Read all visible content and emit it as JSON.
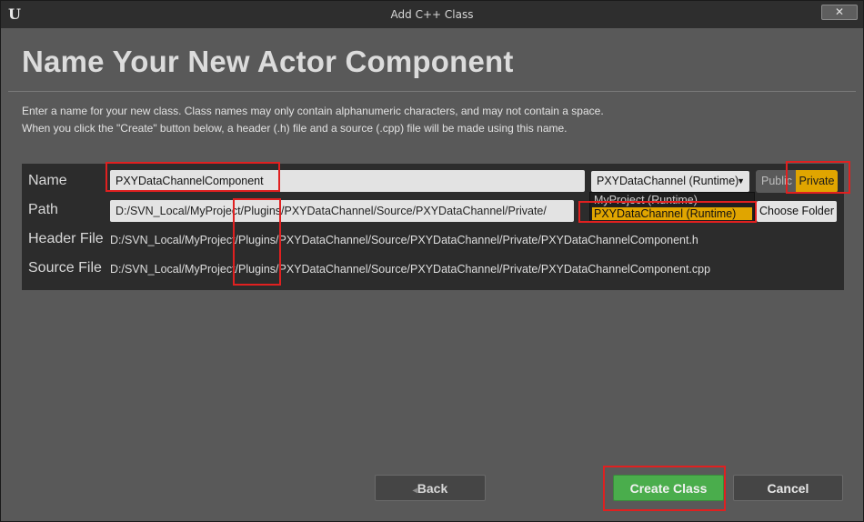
{
  "window": {
    "title": "Add C++ Class",
    "close_label": "✕"
  },
  "heading": "Name Your New Actor Component",
  "description": {
    "line1": "Enter a name for your new class. Class names may only contain alphanumeric characters, and may not contain a space.",
    "line2": "When you click the \"Create\" button below, a header (.h) file and a source (.cpp) file will be made using this name."
  },
  "form": {
    "name_label": "Name",
    "name_value": "PXYDataChannelComponent",
    "path_label": "Path",
    "path_value": "D:/SVN_Local/MyProject/Plugins/PXYDataChannel/Source/PXYDataChannel/Private/",
    "header_label": "Header File",
    "header_value": "D:/SVN_Local/MyProject/Plugins/PXYDataChannel/Source/PXYDataChannel/Private/PXYDataChannelComponent.h",
    "source_label": "Source File",
    "source_value": "D:/SVN_Local/MyProject/Plugins/PXYDataChannel/Source/PXYDataChannel/Private/PXYDataChannelComponent.cpp"
  },
  "module": {
    "selected": "PXYDataChannel (Runtime)",
    "options": [
      "MyProject (Runtime)",
      "PXYDataChannel (Runtime)"
    ]
  },
  "visibility": {
    "public_label": "Public",
    "private_label": "Private",
    "selected": "Private"
  },
  "choose_folder_label": "Choose Folder",
  "footer": {
    "back_label": "Back",
    "create_label": "Create Class",
    "cancel_label": "Cancel"
  },
  "colors": {
    "accent": "#e0a500",
    "create": "#4aad4c",
    "annotation": "#e02020"
  }
}
